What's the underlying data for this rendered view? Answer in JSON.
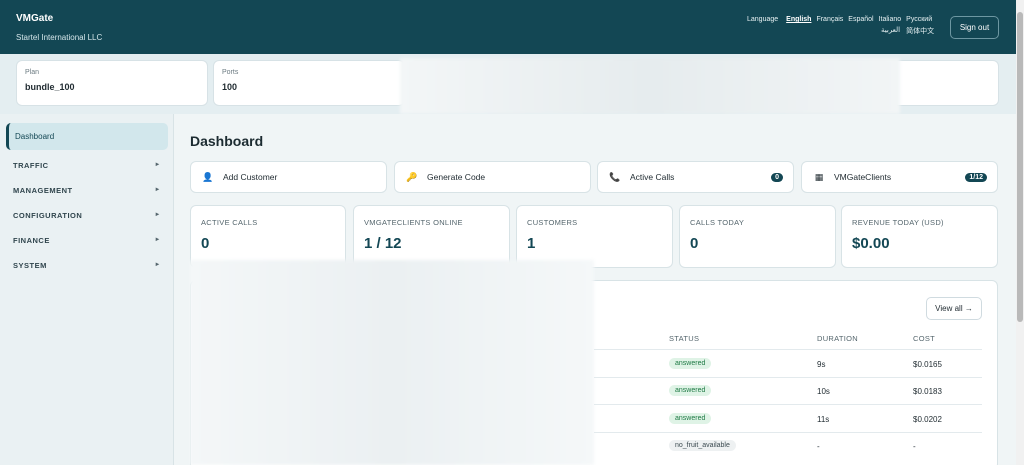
{
  "header": {
    "app_name": "VMGate",
    "company": "Startel International LLC",
    "language_label": "Language",
    "languages_row1": [
      "English",
      "Français",
      "Español",
      "Italiano",
      "Русский"
    ],
    "languages_row2": [
      "العربية",
      "简体中文"
    ],
    "active_language": "English",
    "sign_out": "Sign out"
  },
  "strip": {
    "plan_label": "Plan",
    "plan_value": "bundle_100",
    "ports_label": "Ports",
    "ports_value": "100"
  },
  "sidebar": {
    "active": "Dashboard",
    "items": [
      "TRAFFIC",
      "MANAGEMENT",
      "CONFIGURATION",
      "FINANCE",
      "SYSTEM"
    ],
    "arrow": "►"
  },
  "main": {
    "title": "Dashboard",
    "quick_actions": [
      {
        "label": "Add Customer",
        "icon": "user-icon",
        "glyph": "👤"
      },
      {
        "label": "Generate Code",
        "icon": "key-icon",
        "glyph": "🔑"
      },
      {
        "label": "Active Calls",
        "icon": "phone-icon",
        "glyph": "📞",
        "badge": "0"
      },
      {
        "label": "VMGateClients",
        "icon": "sim-icon",
        "glyph": "▦",
        "badge": "1/12"
      }
    ],
    "kpis": [
      {
        "label": "ACTIVE CALLS",
        "value": "0"
      },
      {
        "label": "VMGATECLIENTS ONLINE",
        "value": "1 / 12"
      },
      {
        "label": "CUSTOMERS",
        "value": "1"
      },
      {
        "label": "CALLS TODAY",
        "value": "0"
      },
      {
        "label": "REVENUE TODAY (USD)",
        "value": "$0.00"
      }
    ],
    "recent": {
      "view_all": "View all →",
      "columns": [
        "STATUS",
        "DURATION",
        "COST"
      ],
      "rows": [
        {
          "status": "answered",
          "duration": "9s",
          "cost": "$0.0165"
        },
        {
          "status": "answered",
          "duration": "10s",
          "cost": "$0.0183"
        },
        {
          "status": "answered",
          "duration": "11s",
          "cost": "$0.0202"
        },
        {
          "status": "no_fruit_available",
          "duration": "-",
          "cost": "-"
        }
      ]
    }
  },
  "colors": {
    "header_bg": "#134754",
    "accent": "#134754",
    "answered_bg": "#dff3e6",
    "answered_text": "#1e7a44"
  }
}
